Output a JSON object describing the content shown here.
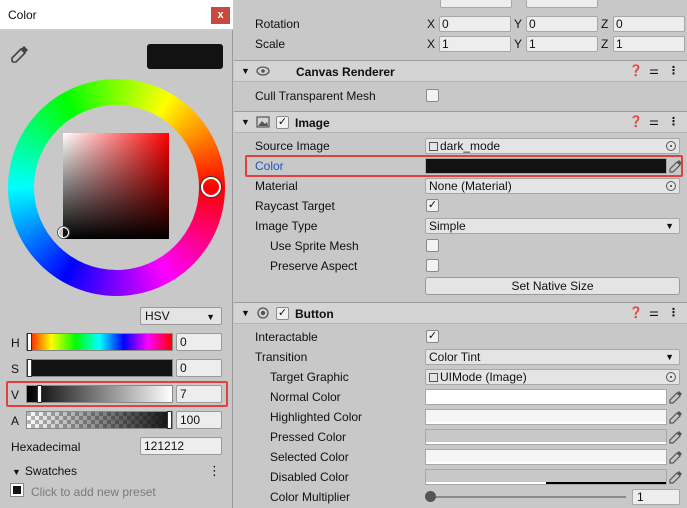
{
  "picker": {
    "title": "Color",
    "close": "x",
    "mode": "HSV",
    "channels": [
      {
        "label": "H",
        "value": "0",
        "fraction": 0
      },
      {
        "label": "S",
        "value": "0",
        "fraction": 0
      },
      {
        "label": "V",
        "value": "7",
        "fraction": 0.07
      },
      {
        "label": "A",
        "value": "100",
        "fraction": 1.0
      }
    ],
    "hex_label": "Hexadecimal",
    "hex_value": "121212",
    "swatches_label": "Swatches",
    "add_preset": "Click to add new preset",
    "current_color": "#121212"
  },
  "inspector": {
    "transform": {
      "rotation_label": "Rotation",
      "scale_label": "Scale",
      "rotation": [
        "0",
        "0",
        "0"
      ],
      "scale": [
        "1",
        "1",
        "1"
      ],
      "axes": [
        "X",
        "Y",
        "Z"
      ]
    },
    "canvas_renderer": {
      "title": "Canvas Renderer",
      "cull_label": "Cull Transparent Mesh"
    },
    "image": {
      "title": "Image",
      "source_image_label": "Source Image",
      "source_image_value": "dark_mode",
      "color_label": "Color",
      "color_value": "#121212",
      "material_label": "Material",
      "material_value": "None (Material)",
      "raycast_label": "Raycast Target",
      "image_type_label": "Image Type",
      "image_type_value": "Simple",
      "sprite_mesh_label": "Use Sprite Mesh",
      "preserve_label": "Preserve Aspect",
      "native_size_button": "Set Native Size"
    },
    "button": {
      "title": "Button",
      "interactable_label": "Interactable",
      "transition_label": "Transition",
      "transition_value": "Color Tint",
      "target_graphic_label": "Target Graphic",
      "target_graphic_value": "UIMode (Image)",
      "normal_label": "Normal Color",
      "highlighted_label": "Highlighted Color",
      "pressed_label": "Pressed Color",
      "selected_label": "Selected Color",
      "disabled_label": "Disabled Color",
      "multiplier_label": "Color Multiplier",
      "multiplier_value": "1"
    }
  },
  "colors": {
    "highlight": "#e0403e",
    "selected_label": "#2456b8"
  }
}
